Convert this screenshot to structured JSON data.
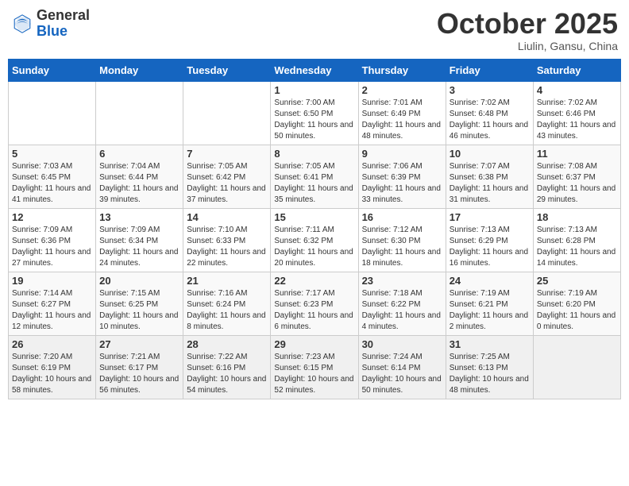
{
  "header": {
    "logo_general": "General",
    "logo_blue": "Blue",
    "month": "October 2025",
    "location": "Liulin, Gansu, China"
  },
  "days_of_week": [
    "Sunday",
    "Monday",
    "Tuesday",
    "Wednesday",
    "Thursday",
    "Friday",
    "Saturday"
  ],
  "weeks": [
    [
      {
        "day": "",
        "sunrise": "",
        "sunset": "",
        "daylight": ""
      },
      {
        "day": "",
        "sunrise": "",
        "sunset": "",
        "daylight": ""
      },
      {
        "day": "",
        "sunrise": "",
        "sunset": "",
        "daylight": ""
      },
      {
        "day": "1",
        "sunrise": "Sunrise: 7:00 AM",
        "sunset": "Sunset: 6:50 PM",
        "daylight": "Daylight: 11 hours and 50 minutes."
      },
      {
        "day": "2",
        "sunrise": "Sunrise: 7:01 AM",
        "sunset": "Sunset: 6:49 PM",
        "daylight": "Daylight: 11 hours and 48 minutes."
      },
      {
        "day": "3",
        "sunrise": "Sunrise: 7:02 AM",
        "sunset": "Sunset: 6:48 PM",
        "daylight": "Daylight: 11 hours and 46 minutes."
      },
      {
        "day": "4",
        "sunrise": "Sunrise: 7:02 AM",
        "sunset": "Sunset: 6:46 PM",
        "daylight": "Daylight: 11 hours and 43 minutes."
      }
    ],
    [
      {
        "day": "5",
        "sunrise": "Sunrise: 7:03 AM",
        "sunset": "Sunset: 6:45 PM",
        "daylight": "Daylight: 11 hours and 41 minutes."
      },
      {
        "day": "6",
        "sunrise": "Sunrise: 7:04 AM",
        "sunset": "Sunset: 6:44 PM",
        "daylight": "Daylight: 11 hours and 39 minutes."
      },
      {
        "day": "7",
        "sunrise": "Sunrise: 7:05 AM",
        "sunset": "Sunset: 6:42 PM",
        "daylight": "Daylight: 11 hours and 37 minutes."
      },
      {
        "day": "8",
        "sunrise": "Sunrise: 7:05 AM",
        "sunset": "Sunset: 6:41 PM",
        "daylight": "Daylight: 11 hours and 35 minutes."
      },
      {
        "day": "9",
        "sunrise": "Sunrise: 7:06 AM",
        "sunset": "Sunset: 6:39 PM",
        "daylight": "Daylight: 11 hours and 33 minutes."
      },
      {
        "day": "10",
        "sunrise": "Sunrise: 7:07 AM",
        "sunset": "Sunset: 6:38 PM",
        "daylight": "Daylight: 11 hours and 31 minutes."
      },
      {
        "day": "11",
        "sunrise": "Sunrise: 7:08 AM",
        "sunset": "Sunset: 6:37 PM",
        "daylight": "Daylight: 11 hours and 29 minutes."
      }
    ],
    [
      {
        "day": "12",
        "sunrise": "Sunrise: 7:09 AM",
        "sunset": "Sunset: 6:36 PM",
        "daylight": "Daylight: 11 hours and 27 minutes."
      },
      {
        "day": "13",
        "sunrise": "Sunrise: 7:09 AM",
        "sunset": "Sunset: 6:34 PM",
        "daylight": "Daylight: 11 hours and 24 minutes."
      },
      {
        "day": "14",
        "sunrise": "Sunrise: 7:10 AM",
        "sunset": "Sunset: 6:33 PM",
        "daylight": "Daylight: 11 hours and 22 minutes."
      },
      {
        "day": "15",
        "sunrise": "Sunrise: 7:11 AM",
        "sunset": "Sunset: 6:32 PM",
        "daylight": "Daylight: 11 hours and 20 minutes."
      },
      {
        "day": "16",
        "sunrise": "Sunrise: 7:12 AM",
        "sunset": "Sunset: 6:30 PM",
        "daylight": "Daylight: 11 hours and 18 minutes."
      },
      {
        "day": "17",
        "sunrise": "Sunrise: 7:13 AM",
        "sunset": "Sunset: 6:29 PM",
        "daylight": "Daylight: 11 hours and 16 minutes."
      },
      {
        "day": "18",
        "sunrise": "Sunrise: 7:13 AM",
        "sunset": "Sunset: 6:28 PM",
        "daylight": "Daylight: 11 hours and 14 minutes."
      }
    ],
    [
      {
        "day": "19",
        "sunrise": "Sunrise: 7:14 AM",
        "sunset": "Sunset: 6:27 PM",
        "daylight": "Daylight: 11 hours and 12 minutes."
      },
      {
        "day": "20",
        "sunrise": "Sunrise: 7:15 AM",
        "sunset": "Sunset: 6:25 PM",
        "daylight": "Daylight: 11 hours and 10 minutes."
      },
      {
        "day": "21",
        "sunrise": "Sunrise: 7:16 AM",
        "sunset": "Sunset: 6:24 PM",
        "daylight": "Daylight: 11 hours and 8 minutes."
      },
      {
        "day": "22",
        "sunrise": "Sunrise: 7:17 AM",
        "sunset": "Sunset: 6:23 PM",
        "daylight": "Daylight: 11 hours and 6 minutes."
      },
      {
        "day": "23",
        "sunrise": "Sunrise: 7:18 AM",
        "sunset": "Sunset: 6:22 PM",
        "daylight": "Daylight: 11 hours and 4 minutes."
      },
      {
        "day": "24",
        "sunrise": "Sunrise: 7:19 AM",
        "sunset": "Sunset: 6:21 PM",
        "daylight": "Daylight: 11 hours and 2 minutes."
      },
      {
        "day": "25",
        "sunrise": "Sunrise: 7:19 AM",
        "sunset": "Sunset: 6:20 PM",
        "daylight": "Daylight: 11 hours and 0 minutes."
      }
    ],
    [
      {
        "day": "26",
        "sunrise": "Sunrise: 7:20 AM",
        "sunset": "Sunset: 6:19 PM",
        "daylight": "Daylight: 10 hours and 58 minutes."
      },
      {
        "day": "27",
        "sunrise": "Sunrise: 7:21 AM",
        "sunset": "Sunset: 6:17 PM",
        "daylight": "Daylight: 10 hours and 56 minutes."
      },
      {
        "day": "28",
        "sunrise": "Sunrise: 7:22 AM",
        "sunset": "Sunset: 6:16 PM",
        "daylight": "Daylight: 10 hours and 54 minutes."
      },
      {
        "day": "29",
        "sunrise": "Sunrise: 7:23 AM",
        "sunset": "Sunset: 6:15 PM",
        "daylight": "Daylight: 10 hours and 52 minutes."
      },
      {
        "day": "30",
        "sunrise": "Sunrise: 7:24 AM",
        "sunset": "Sunset: 6:14 PM",
        "daylight": "Daylight: 10 hours and 50 minutes."
      },
      {
        "day": "31",
        "sunrise": "Sunrise: 7:25 AM",
        "sunset": "Sunset: 6:13 PM",
        "daylight": "Daylight: 10 hours and 48 minutes."
      },
      {
        "day": "",
        "sunrise": "",
        "sunset": "",
        "daylight": ""
      }
    ]
  ]
}
